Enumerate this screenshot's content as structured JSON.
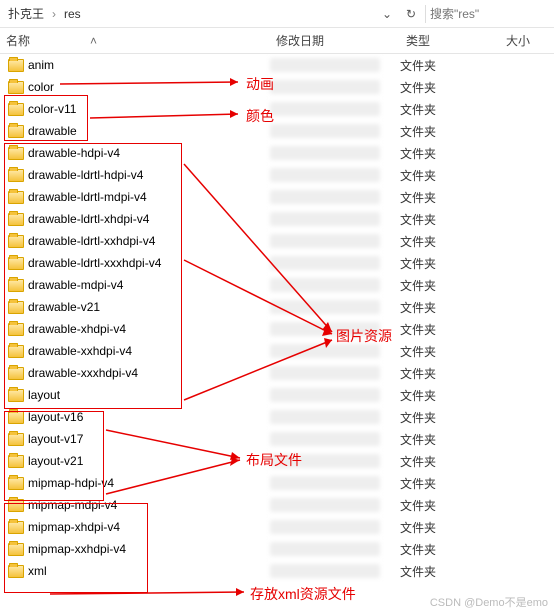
{
  "breadcrumb": {
    "parent": "扑克王",
    "current": "res"
  },
  "search": {
    "placeholder": "搜索\"res\""
  },
  "columns": {
    "name": "名称",
    "date": "修改日期",
    "type": "类型",
    "size": "大小"
  },
  "type_label": "文件夹",
  "folders": [
    {
      "name": "anim"
    },
    {
      "name": "color"
    },
    {
      "name": "color-v11"
    },
    {
      "name": "drawable"
    },
    {
      "name": "drawable-hdpi-v4"
    },
    {
      "name": "drawable-ldrtl-hdpi-v4"
    },
    {
      "name": "drawable-ldrtl-mdpi-v4"
    },
    {
      "name": "drawable-ldrtl-xhdpi-v4"
    },
    {
      "name": "drawable-ldrtl-xxhdpi-v4"
    },
    {
      "name": "drawable-ldrtl-xxxhdpi-v4"
    },
    {
      "name": "drawable-mdpi-v4"
    },
    {
      "name": "drawable-v21"
    },
    {
      "name": "drawable-xhdpi-v4"
    },
    {
      "name": "drawable-xxhdpi-v4"
    },
    {
      "name": "drawable-xxxhdpi-v4"
    },
    {
      "name": "layout"
    },
    {
      "name": "layout-v16"
    },
    {
      "name": "layout-v17"
    },
    {
      "name": "layout-v21"
    },
    {
      "name": "mipmap-hdpi-v4"
    },
    {
      "name": "mipmap-mdpi-v4"
    },
    {
      "name": "mipmap-xhdpi-v4"
    },
    {
      "name": "mipmap-xxhdpi-v4"
    },
    {
      "name": "xml"
    }
  ],
  "annotations": {
    "anim": "动画",
    "color": "颜色",
    "drawable": "图片资源",
    "layout": "布局文件",
    "xml": "存放xml资源文件"
  },
  "watermark": "CSDN @Demo不是emo"
}
